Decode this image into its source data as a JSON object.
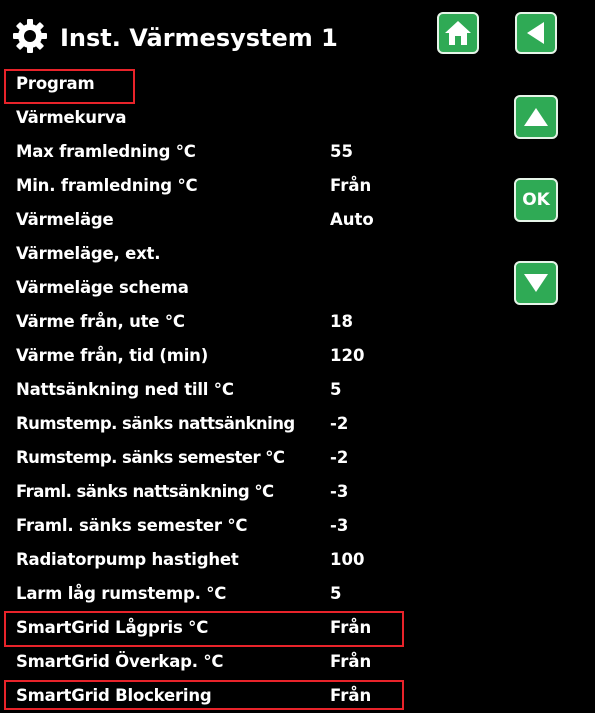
{
  "header": {
    "title": "Inst. Värmesystem 1",
    "icons": {
      "settings": "gear-icon",
      "home": "home-icon",
      "back": "back-arrow-icon"
    }
  },
  "nav": {
    "up_icon": "up-arrow-icon",
    "ok_label": "OK",
    "down_icon": "down-arrow-icon"
  },
  "colors": {
    "background": "#000000",
    "text": "#ffffff",
    "button": "#2faa55",
    "highlight": "#e8232a"
  },
  "menu": {
    "items": [
      {
        "label": "Program",
        "value": ""
      },
      {
        "label": "Värmekurva",
        "value": ""
      },
      {
        "label": "Max framledning °C",
        "value": "55"
      },
      {
        "label": "Min. framledning °C",
        "value": "Från"
      },
      {
        "label": "Värmeläge",
        "value": "Auto"
      },
      {
        "label": "Värmeläge, ext.",
        "value": ""
      },
      {
        "label": "Värmeläge schema",
        "value": ""
      },
      {
        "label": "Värme från, ute °C",
        "value": "18"
      },
      {
        "label": "Värme från, tid (min)",
        "value": "120"
      },
      {
        "label": "Nattsänkning ned till °C",
        "value": "5"
      },
      {
        "label": "Rumstemp. sänks nattsänkning",
        "value": "-2"
      },
      {
        "label": "Rumstemp. sänks semester °C",
        "value": "-2"
      },
      {
        "label": "Framl. sänks nattsänkning °C",
        "value": "-3"
      },
      {
        "label": "Framl. sänks semester °C",
        "value": "-3"
      },
      {
        "label": "Radiatorpump hastighet",
        "value": "100"
      },
      {
        "label": "Larm låg rumstemp. °C",
        "value": "5"
      },
      {
        "label": "SmartGrid Lågpris °C",
        "value": "Från"
      },
      {
        "label": "SmartGrid Överkap. °C",
        "value": "Från"
      },
      {
        "label": "SmartGrid Blockering",
        "value": "Från"
      }
    ]
  }
}
